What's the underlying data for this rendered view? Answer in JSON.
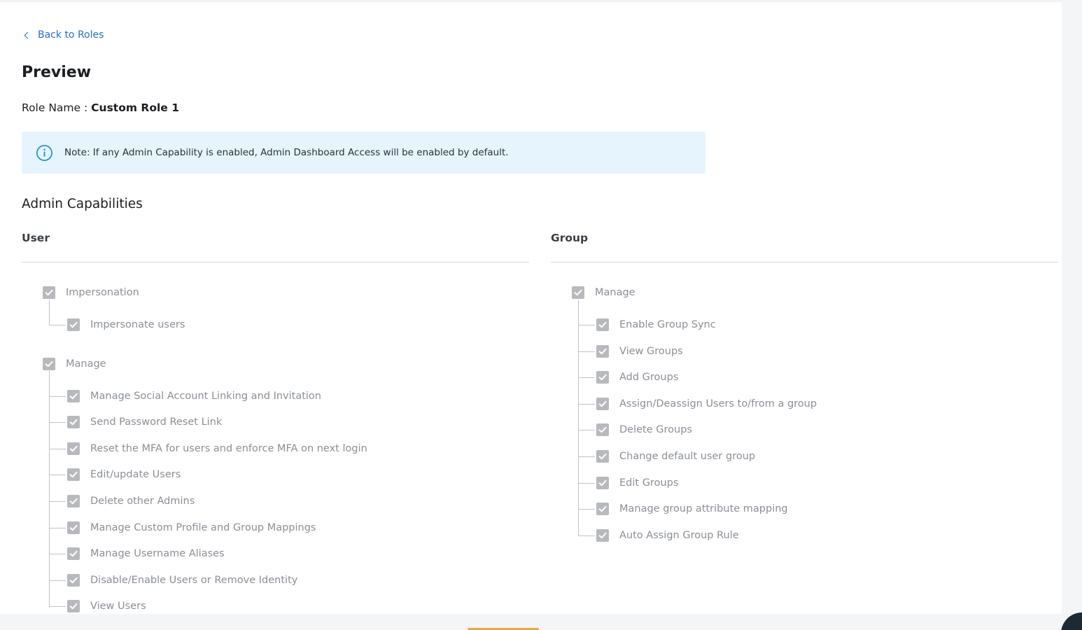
{
  "nav": {
    "back_label": "Back to Roles"
  },
  "page": {
    "title": "Preview",
    "role_label": "Role Name :",
    "role_value": "Custom Role 1"
  },
  "note": {
    "text": "Note: If any Admin Capability is enabled, Admin Dashboard Access will be enabled by default."
  },
  "section": {
    "title": "Admin Capabilities"
  },
  "columns": {
    "user": {
      "header": "User",
      "groups": [
        {
          "label": "Impersonation",
          "checked": true,
          "children": [
            "Impersonate users"
          ]
        },
        {
          "label": "Manage",
          "checked": true,
          "children": [
            "Manage Social Account Linking and Invitation",
            "Send Password Reset Link",
            "Reset the MFA for users and enforce MFA on next login",
            "Edit/update Users",
            "Delete other Admins",
            "Manage Custom Profile and Group Mappings",
            "Manage Username Aliases",
            "Disable/Enable Users or Remove Identity",
            "View Users"
          ]
        }
      ]
    },
    "group": {
      "header": "Group",
      "groups": [
        {
          "label": "Manage",
          "checked": true,
          "children": [
            "Enable Group Sync",
            "View Groups",
            "Add Groups",
            "Assign/Deassign Users to/from a group",
            "Delete Groups",
            "Change default user group",
            "Edit Groups",
            "Manage group attribute mapping",
            "Auto Assign Group Rule"
          ]
        }
      ]
    }
  },
  "theme": {
    "link": "#1f6fd1",
    "note_bg": "#e6f5fd",
    "checkbox_disabled": "#b7b9bd",
    "label_disabled": "#8a8f96"
  }
}
